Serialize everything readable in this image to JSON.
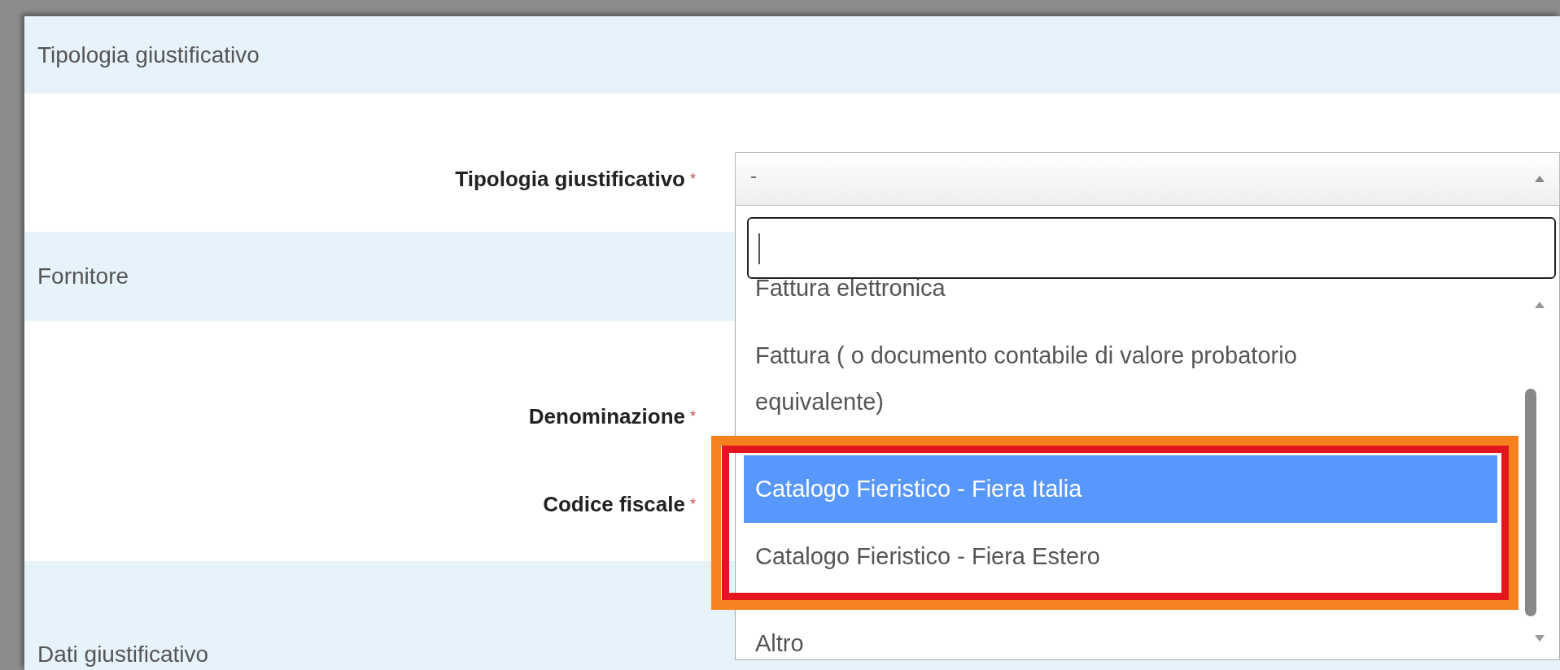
{
  "sections": [
    {
      "title": "Tipologia giustificativo",
      "fields": [
        {
          "label": "Tipologia giustificativo",
          "required_mark": "*",
          "kind": "select",
          "value": "-"
        }
      ]
    },
    {
      "title": "Fornitore",
      "fields": [
        {
          "label": "Denominazione",
          "required_mark": "*",
          "kind": "text"
        },
        {
          "label": "Codice fiscale",
          "required_mark": "*",
          "kind": "text"
        }
      ]
    },
    {
      "title": "Dati giustificativo"
    }
  ],
  "dropdown": {
    "options": [
      {
        "label": "Fattura elettronica",
        "selected": false,
        "highlighted": false
      },
      {
        "label": "Fattura ( o documento contabile di valore probatorio equivalente)",
        "selected": false,
        "highlighted": false
      },
      {
        "label": "Catalogo Fieristico - Fiera Italia",
        "selected": true,
        "highlighted": true
      },
      {
        "label": "Catalogo Fieristico - Fiera Estero",
        "selected": false,
        "highlighted": true
      },
      {
        "label": "Altro",
        "selected": false,
        "highlighted": false
      }
    ]
  }
}
